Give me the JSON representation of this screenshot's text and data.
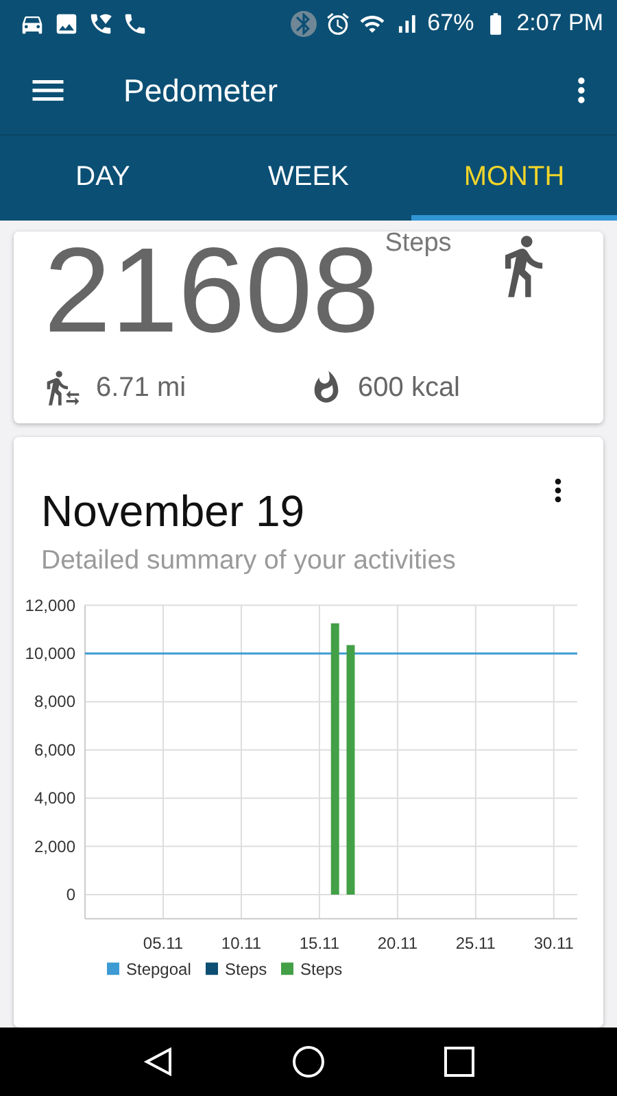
{
  "status_bar": {
    "battery": "67%",
    "time": "2:07 PM"
  },
  "app_bar": {
    "title": "Pedometer"
  },
  "tabs": [
    {
      "label": "DAY",
      "selected": false
    },
    {
      "label": "WEEK",
      "selected": false
    },
    {
      "label": "MONTH",
      "selected": true
    }
  ],
  "summary": {
    "steps": "21608",
    "steps_unit": "Steps",
    "distance": "6.71",
    "distance_unit": "mi",
    "calories": "600",
    "calories_unit": "kcal"
  },
  "detail": {
    "title": "November 19",
    "subtitle": "Detailed summary of your activities",
    "chart_data": {
      "type": "bar",
      "stacked": false,
      "categories": [
        null,
        null,
        null,
        null,
        "05.11",
        null,
        null,
        null,
        null,
        "10.11",
        null,
        null,
        null,
        null,
        "15.11",
        null,
        null,
        null,
        null,
        "20.11",
        null,
        null,
        null,
        null,
        "25.11",
        null,
        null,
        null,
        null,
        "30.11",
        null
      ],
      "ylim": [
        -1000,
        12000
      ],
      "grid": true,
      "legend": "bottom",
      "ref_lines": [
        {
          "axis": "y",
          "value": 10000,
          "label": "Stepgoal",
          "color": "#3d9ad3"
        }
      ],
      "yticks": [
        {
          "value": 0,
          "label": "0"
        },
        {
          "value": 2000,
          "label": "2,000"
        },
        {
          "value": 4000,
          "label": "4,000"
        },
        {
          "value": 6000,
          "label": "6,000"
        },
        {
          "value": 8000,
          "label": "8,000"
        },
        {
          "value": 10000,
          "label": "10,000"
        },
        {
          "value": 12000,
          "label": "12,000"
        }
      ],
      "series": [
        {
          "name": "Steps",
          "color": "#0d4e73",
          "values": [
            null,
            null,
            null,
            null,
            null,
            null,
            null,
            null,
            null,
            null,
            null,
            null,
            null,
            null,
            null,
            null,
            null,
            null,
            null,
            null,
            null,
            null,
            null,
            null,
            null,
            null,
            null,
            null,
            null,
            null,
            null
          ]
        },
        {
          "name": "Steps",
          "color": "#43a047",
          "values": [
            null,
            null,
            null,
            null,
            null,
            null,
            null,
            null,
            null,
            null,
            null,
            null,
            null,
            null,
            null,
            11250,
            10350,
            null,
            null,
            null,
            null,
            null,
            null,
            null,
            null,
            null,
            null,
            null,
            null,
            null,
            null
          ]
        }
      ]
    }
  }
}
